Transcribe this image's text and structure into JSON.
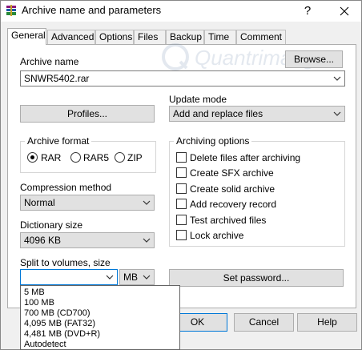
{
  "window": {
    "title": "Archive name and parameters"
  },
  "tabs": [
    "General",
    "Advanced",
    "Options",
    "Files",
    "Backup",
    "Time",
    "Comment"
  ],
  "archive_name": {
    "label": "Archive name",
    "browse_label": "Browse...",
    "value": "SNWR5402.rar"
  },
  "profiles_label": "Profiles...",
  "update_mode": {
    "label": "Update mode",
    "value": "Add and replace files"
  },
  "archive_format": {
    "title": "Archive format",
    "options": [
      "RAR",
      "RAR5",
      "ZIP"
    ],
    "selected": "RAR"
  },
  "archiving_options": {
    "title": "Archiving options",
    "items": [
      "Delete files after archiving",
      "Create SFX archive",
      "Create solid archive",
      "Add recovery record",
      "Test archived files",
      "Lock archive"
    ]
  },
  "compression": {
    "label": "Compression method",
    "value": "Normal"
  },
  "dictionary": {
    "label": "Dictionary size",
    "value": "4096 KB"
  },
  "split": {
    "label": "Split to volumes, size",
    "value": "",
    "unit": "MB"
  },
  "set_password_label": "Set password...",
  "split_options": [
    "5 MB",
    "100 MB",
    "700 MB  (CD700)",
    "4,095 MB  (FAT32)",
    "4,481 MB  (DVD+R)",
    "Autodetect"
  ],
  "footer": {
    "ok": "OK",
    "cancel": "Cancel",
    "help": "Help"
  },
  "watermark": "Quantrimang"
}
